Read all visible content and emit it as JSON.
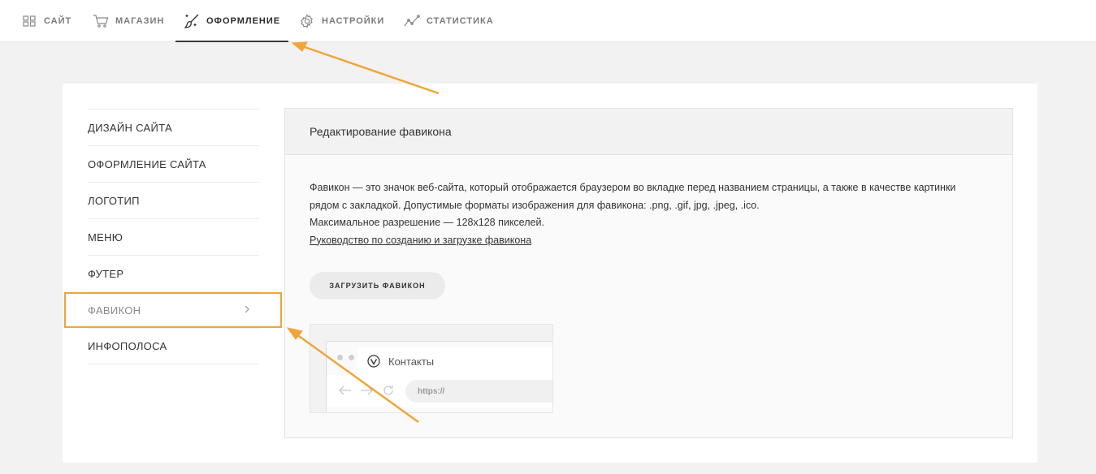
{
  "topnav": {
    "tabs": [
      {
        "label": "САЙТ",
        "icon": "grid-icon"
      },
      {
        "label": "МАГАЗИН",
        "icon": "cart-icon"
      },
      {
        "label": "ОФОРМЛЕНИЕ",
        "icon": "magic-brush-icon",
        "active": true
      },
      {
        "label": "НАСТРОЙКИ",
        "icon": "gear-icon"
      },
      {
        "label": "СТАТИСТИКА",
        "icon": "chart-line-icon"
      }
    ]
  },
  "sidebar": {
    "items": [
      {
        "label": "ДИЗАЙН САЙТА"
      },
      {
        "label": "ОФОРМЛЕНИЕ САЙТА"
      },
      {
        "label": "ЛОГОТИП"
      },
      {
        "label": "МЕНЮ"
      },
      {
        "label": "ФУТЕР"
      },
      {
        "label": "ФАВИКОН",
        "active": true
      },
      {
        "label": "ИНФОПОЛОСА"
      }
    ]
  },
  "panel": {
    "title": "Редактирование фавикона",
    "description_line1": "Фавикон — это значок веб-сайта, который отображается браузером во вкладке перед названием страницы, а также в качестве картинки рядом с закладкой. Допустимые форматы изображения для фавикона: .png, .gif, jpg, .jpeg, .ico.",
    "description_line2": "Максимальное разрешение — 128x128 пикселей.",
    "guide_link": "Руководство по созданию и загрузке фавикона",
    "upload_button": "ЗАГРУЗИТЬ ФАВИКОН"
  },
  "preview": {
    "tab_title": "Контакты",
    "url": "https://"
  },
  "colors": {
    "annotation": "#f0a43a",
    "active_underline": "#3a3a3a",
    "background": "#f2f2f2"
  }
}
